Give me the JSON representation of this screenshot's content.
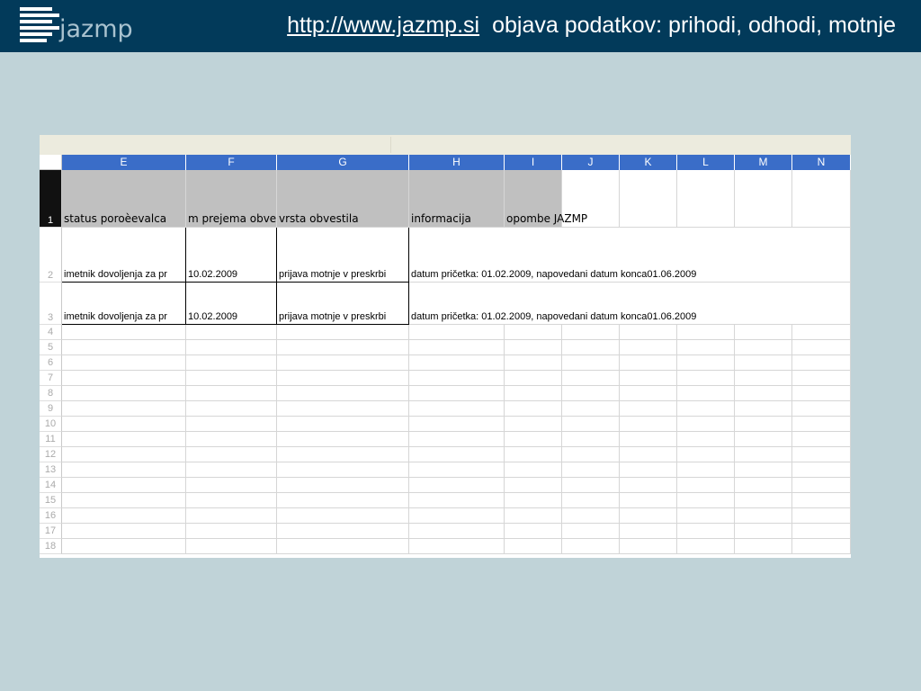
{
  "header": {
    "logo_text": "jazmp",
    "link_text": "http://www.jazmp.si",
    "title_rest": "objava podatkov:  prihodi, odhodi, motnje"
  },
  "sheet": {
    "columns": [
      "E",
      "F",
      "G",
      "H",
      "I",
      "J",
      "K",
      "L",
      "M",
      "N"
    ],
    "row_numbers": [
      "1",
      "2",
      "3",
      "4",
      "5",
      "6",
      "7",
      "8",
      "9",
      "10",
      "11",
      "12",
      "13",
      "14",
      "15",
      "16",
      "17",
      "18"
    ],
    "row1": {
      "e": "status poroèevalca",
      "f": "m prejema obve",
      "g": "vrsta obvestila",
      "h": "informacija",
      "i": "opombe JAZMP"
    },
    "rows": [
      {
        "e": "imetnik dovoljenja za pr",
        "f": "10.02.2009",
        "g": "prijava motnje v preskrbi",
        "h": "datum pričetka: 01.02.2009, napovedani  datum konca01.06.2009"
      },
      {
        "e": "imetnik dovoljenja za pr",
        "f": "10.02.2009",
        "g": "prijava motnje v preskrbi",
        "h": "datum pričetka: 01.02.2009, napovedani  datum konca01.06.2009"
      }
    ]
  }
}
